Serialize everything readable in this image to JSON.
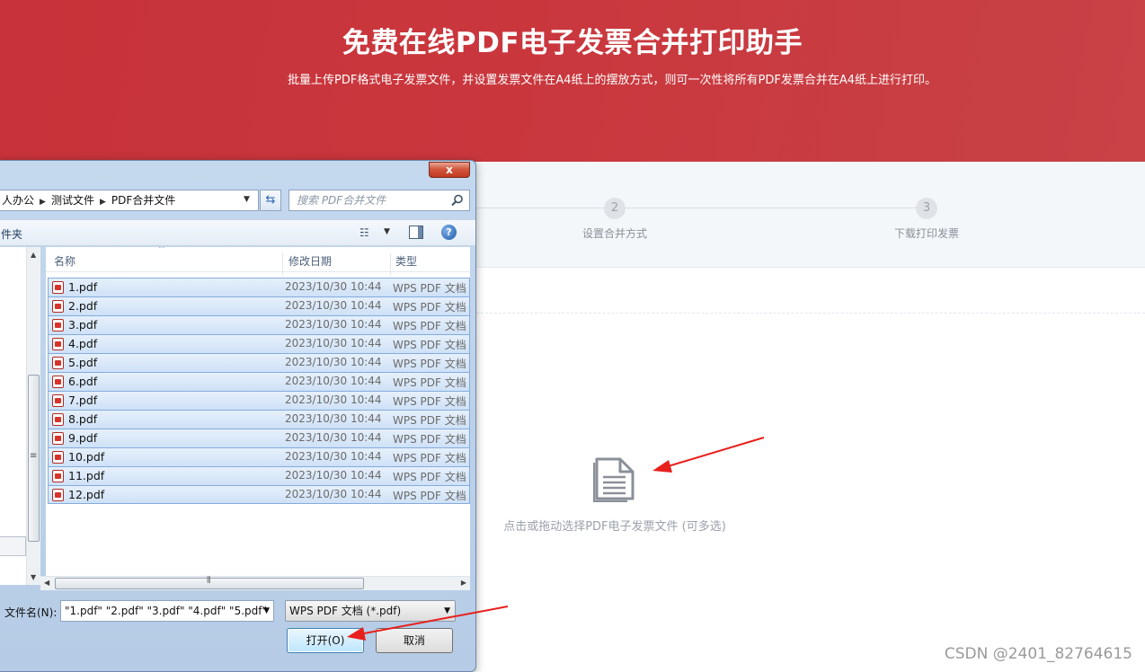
{
  "banner": {
    "title": "免费在线PDF电子发票合并打印助手",
    "subtitle": "批量上传PDF格式电子发票文件，并设置发票文件在A4纸上的摆放方式，则可一次性将所有PDF发票合并在A4纸上进行打印。"
  },
  "steps": [
    {
      "number": "2",
      "label": "设置合并方式"
    },
    {
      "number": "3",
      "label": "下载打印发票"
    }
  ],
  "upload": {
    "icon": "document-icon",
    "hint": "点击或拖动选择PDF电子发票文件 (可多选)"
  },
  "watermark": "CSDN @2401_82764615",
  "dialog": {
    "close_label": "x",
    "breadcrumb": [
      "人办公",
      "测试文件",
      "PDF合并文件"
    ],
    "search_placeholder": "搜索 PDF合并文件",
    "toolbar_label": "件夹",
    "columns": {
      "name": "名称",
      "date": "修改日期",
      "type": "类型"
    },
    "files": [
      {
        "name": "1.pdf",
        "date": "2023/10/30 10:44",
        "type": "WPS PDF 文档"
      },
      {
        "name": "2.pdf",
        "date": "2023/10/30 10:44",
        "type": "WPS PDF 文档"
      },
      {
        "name": "3.pdf",
        "date": "2023/10/30 10:44",
        "type": "WPS PDF 文档"
      },
      {
        "name": "4.pdf",
        "date": "2023/10/30 10:44",
        "type": "WPS PDF 文档"
      },
      {
        "name": "5.pdf",
        "date": "2023/10/30 10:44",
        "type": "WPS PDF 文档"
      },
      {
        "name": "6.pdf",
        "date": "2023/10/30 10:44",
        "type": "WPS PDF 文档"
      },
      {
        "name": "7.pdf",
        "date": "2023/10/30 10:44",
        "type": "WPS PDF 文档"
      },
      {
        "name": "8.pdf",
        "date": "2023/10/30 10:44",
        "type": "WPS PDF 文档"
      },
      {
        "name": "9.pdf",
        "date": "2023/10/30 10:44",
        "type": "WPS PDF 文档"
      },
      {
        "name": "10.pdf",
        "date": "2023/10/30 10:44",
        "type": "WPS PDF 文档"
      },
      {
        "name": "11.pdf",
        "date": "2023/10/30 10:44",
        "type": "WPS PDF 文档"
      },
      {
        "name": "12.pdf",
        "date": "2023/10/30 10:44",
        "type": "WPS PDF 文档"
      }
    ],
    "filename_label": "文件名(N):",
    "filename_value": "\"1.pdf\" \"2.pdf\" \"3.pdf\" \"4.pdf\" \"5.pdf\"",
    "filetype_value": "WPS PDF 文档 (*.pdf)",
    "open_label": "打开(O)",
    "cancel_label": "取消"
  },
  "colors": {
    "banner_red": "#c8373d",
    "annotation_arrow": "#e8201c",
    "selection_blue": "#cfe1f7"
  }
}
